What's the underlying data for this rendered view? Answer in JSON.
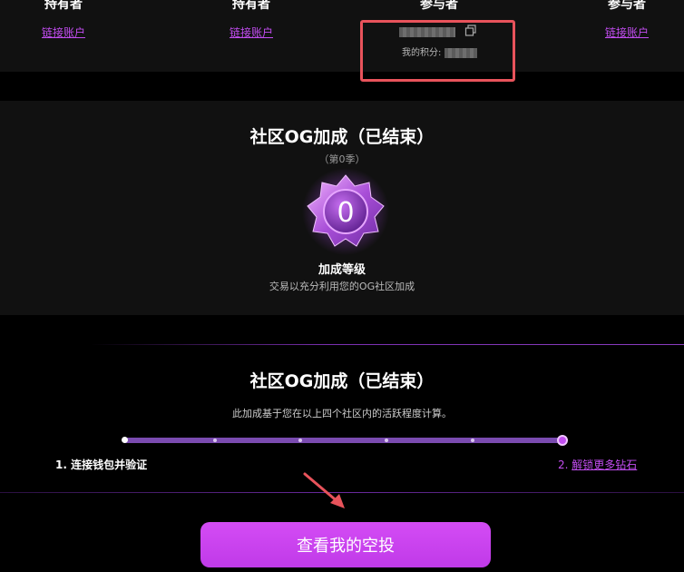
{
  "header": {
    "columns": [
      {
        "title": "持有者",
        "link": "链接账户"
      },
      {
        "title": "持有者",
        "link": "链接账户"
      },
      {
        "title": "参与者"
      },
      {
        "title": "参与者",
        "link": "链接账户"
      }
    ],
    "participant": {
      "points_label": "我的积分:"
    }
  },
  "og_boost": {
    "title": "社区OG加成（已结束）",
    "season": "（第0季）",
    "badge_value": "0",
    "level_label": "加成等级",
    "level_desc": "交易以充分利用您的OG社区加成"
  },
  "progress_section": {
    "title": "社区OG加成（已结束）",
    "description": "此加成基于您在以上四个社区内的活跃程度计算。",
    "progress": 1.0,
    "step1": "1. 连接钱包并验证",
    "step2_num": "2. ",
    "step2_link": "解锁更多钻石"
  },
  "cta": {
    "label": "查看我的空投"
  },
  "colors": {
    "accent": "#c24df0",
    "highlight_box": "#e8535b",
    "panel": "#111111"
  }
}
